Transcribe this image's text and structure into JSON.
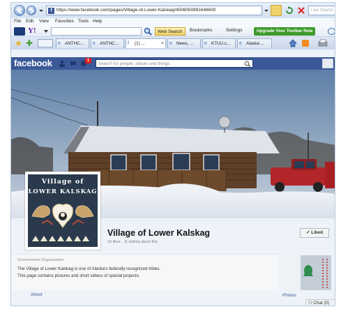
{
  "browser": {
    "url": "https://www.facebook.com/pages/Village-of-Lower-Kalskag/4506050891646600",
    "live_search_placeholder": "Live Search",
    "menu": [
      "File",
      "Edit",
      "View",
      "Favorites",
      "Tools",
      "Help"
    ],
    "yahoo_logo": "Y!",
    "web_search_label": "Web Search",
    "bookmarks_label": "Bookmarks",
    "settings_label": "Settings",
    "upgrade_label": "Upgrade Your Toolbar Now",
    "tabs": [
      {
        "label": "ANTHC...",
        "icon": "e"
      },
      {
        "label": "ANTHC...",
        "icon": "e"
      },
      {
        "label": "(1) ...",
        "icon": "f"
      },
      {
        "label": "News, ...",
        "icon": "e"
      },
      {
        "label": "KTUU.c...",
        "icon": "e"
      },
      {
        "label": "Alaska ...",
        "icon": "e"
      }
    ]
  },
  "facebook": {
    "logo": "facebook",
    "notification_count": "1",
    "search_placeholder": "Search for people, places and things"
  },
  "page": {
    "seal_line_1": "Village  of",
    "seal_line_2": "LOWER  KALSKAG",
    "title": "Village of Lower Kalskag",
    "stats": "16 likes · 11 talking about this",
    "liked_label": "✓ Liked",
    "category": "Government Organization",
    "description_1": "The Village of Lower Kalskag is one of Alaska's federally recognized tribes.",
    "description_2": "This page contains pictures and short videos of special projects.",
    "about_label": "About",
    "photos_label": "Photos",
    "chat_label": "Chat (0)"
  },
  "colors": {
    "facebook_blue": "#3b5998",
    "upgrade_green": "#3c9a2a",
    "ie_chrome": "#d4e1f0"
  }
}
